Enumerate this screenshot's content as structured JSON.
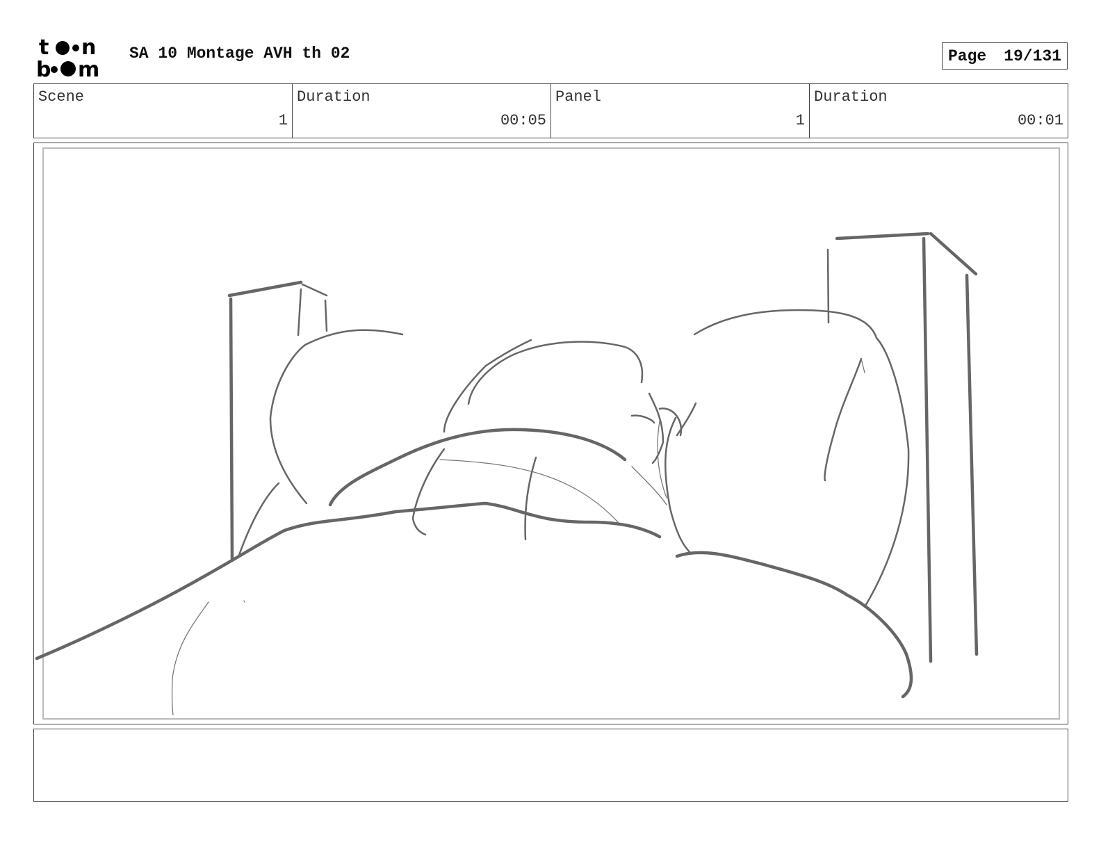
{
  "header": {
    "logo_text": "toon boom",
    "title": "SA 10 Montage AVH th 02",
    "page_label": "Page",
    "page_value": "19/131"
  },
  "info": {
    "scene_label": "Scene",
    "scene_value": "1",
    "scene_duration_label": "Duration",
    "scene_duration_value": "00:05",
    "panel_label": "Panel",
    "panel_value": "1",
    "panel_duration_label": "Duration",
    "panel_duration_value": "00:01"
  },
  "notes": {
    "text": ""
  },
  "colors": {
    "sketch_stroke": "#666666",
    "frame_border": "#444444",
    "inner_border": "#bbbbbb"
  }
}
